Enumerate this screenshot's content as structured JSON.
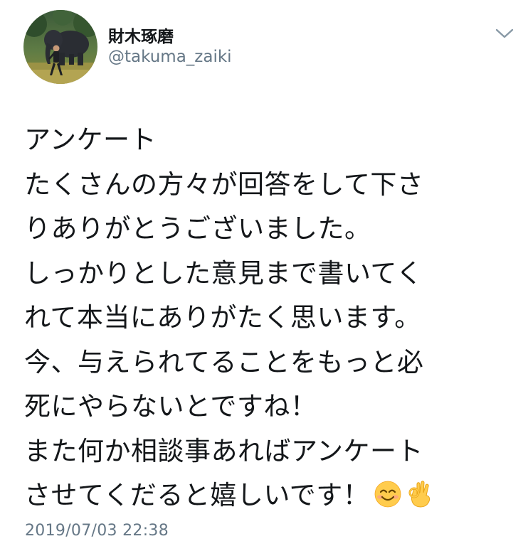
{
  "tweet": {
    "display_name": "財木琢磨",
    "handle": "@takuma_zaiki",
    "lines": [
      "アンケート",
      "たくさんの方々が回答をして下さ",
      "りありがとうございました。",
      "しっかりとした意見まで書いてく",
      "れて本当にありがたく思います。",
      "今、与えられてることをもっと必",
      "死にやらないとですね！",
      "また何か相談事あればアンケート",
      "させてくだると嬉しいです！"
    ],
    "emojis": [
      "smiling-face-emoji",
      "ok-hand-emoji"
    ],
    "timestamp": "2019/07/03 22:38"
  },
  "icons": {
    "caret": "chevron-down-icon"
  },
  "colors": {
    "text": "#14171a",
    "secondary": "#657786",
    "background": "#ffffff"
  }
}
